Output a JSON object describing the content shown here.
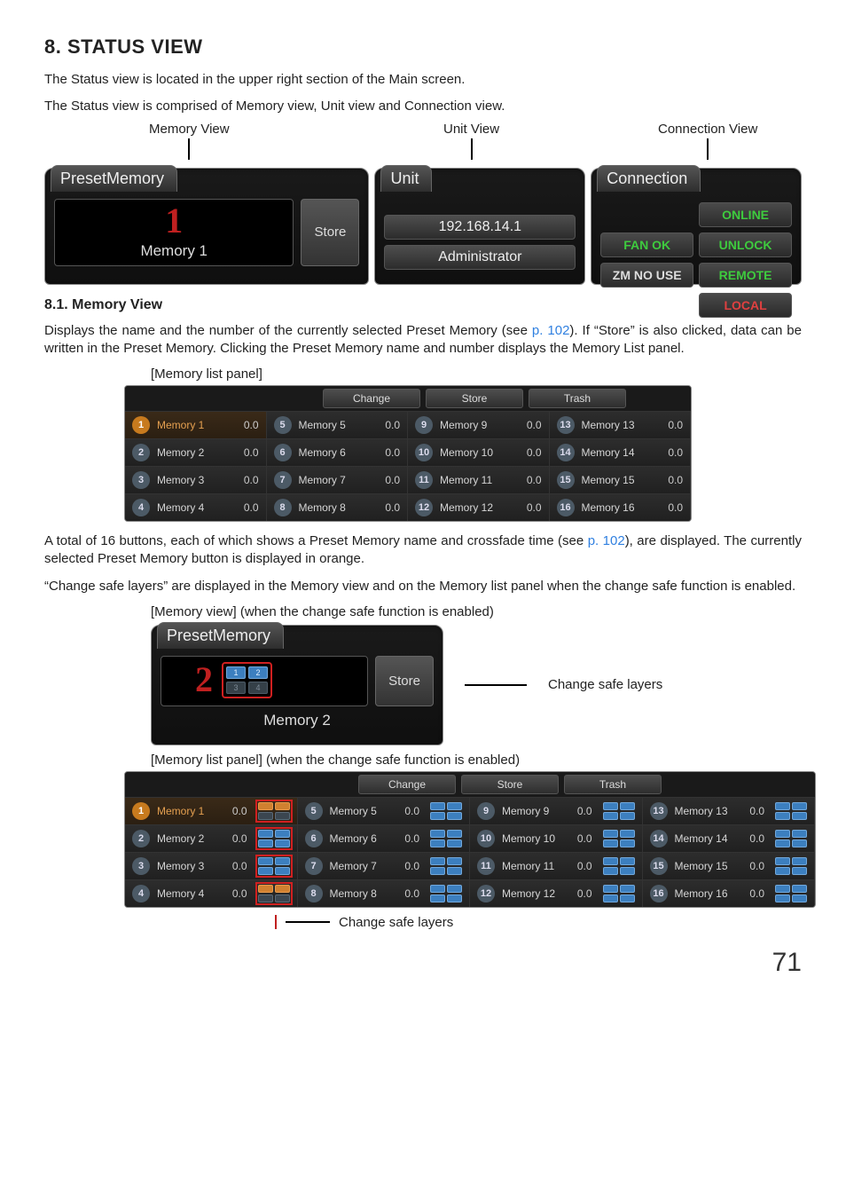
{
  "heading": "8. STATUS VIEW",
  "intro1": "The Status view is located in the upper right section of the Main screen.",
  "intro2": "The Status view is comprised of Memory view, Unit view and Connection view.",
  "labels": {
    "memory_view": "Memory View",
    "unit_view": "Unit View",
    "connection_view": "Connection View"
  },
  "status": {
    "memory": {
      "tab": "PresetMemory",
      "number": "1",
      "name": "Memory 1",
      "store": "Store"
    },
    "unit": {
      "tab": "Unit",
      "ip": "192.168.14.1",
      "role": "Administrator"
    },
    "conn": {
      "tab": "Connection",
      "online": "ONLINE",
      "fan": "FAN OK",
      "unlock": "UNLOCK",
      "zm": "ZM NO USE",
      "remote": "REMOTE",
      "local": "LOCAL"
    }
  },
  "sec81_title": "8.1. Memory View",
  "sec81_p1a": "Displays the name and the number of the currently selected Preset Memory (see ",
  "sec81_p1_link": "p. 102",
  "sec81_p1b": "). If “Store” is also clicked, data can be written in the Preset Memory. Clicking the Preset Memory name and number displays the Memory List panel.",
  "caption_memlist": "[Memory list panel]",
  "memlist_hdr": {
    "change": "Change",
    "store": "Store",
    "trash": "Trash"
  },
  "memlist": [
    {
      "n": "1",
      "name": "Memory 1",
      "t": "0.0",
      "sel": true
    },
    {
      "n": "5",
      "name": "Memory 5",
      "t": "0.0"
    },
    {
      "n": "9",
      "name": "Memory 9",
      "t": "0.0"
    },
    {
      "n": "13",
      "name": "Memory 13",
      "t": "0.0"
    },
    {
      "n": "2",
      "name": "Memory 2",
      "t": "0.0"
    },
    {
      "n": "6",
      "name": "Memory 6",
      "t": "0.0"
    },
    {
      "n": "10",
      "name": "Memory 10",
      "t": "0.0"
    },
    {
      "n": "14",
      "name": "Memory 14",
      "t": "0.0"
    },
    {
      "n": "3",
      "name": "Memory 3",
      "t": "0.0"
    },
    {
      "n": "7",
      "name": "Memory 7",
      "t": "0.0"
    },
    {
      "n": "11",
      "name": "Memory 11",
      "t": "0.0"
    },
    {
      "n": "15",
      "name": "Memory 15",
      "t": "0.0"
    },
    {
      "n": "4",
      "name": "Memory 4",
      "t": "0.0"
    },
    {
      "n": "8",
      "name": "Memory 8",
      "t": "0.0"
    },
    {
      "n": "12",
      "name": "Memory 12",
      "t": "0.0"
    },
    {
      "n": "16",
      "name": "Memory 16",
      "t": "0.0"
    }
  ],
  "para2a": "A total of 16 buttons, each of which shows a Preset Memory name and crossfade time (see ",
  "para2_link": "p. 102",
  "para2b": "), are displayed. The currently selected Preset Memory button is displayed in orange.",
  "para3": "“Change safe layers” are displayed in the Memory view and on the Memory list panel when the change safe function is enabled.",
  "caption_memview_cs": "[Memory view] (when the change safe function is enabled)",
  "preset2": {
    "tab": "PresetMemory",
    "number": "2",
    "name": "Memory 2",
    "store": "Store",
    "layer_labels": [
      "1",
      "2",
      "3",
      "4"
    ]
  },
  "callout_csl": "Change safe layers",
  "caption_memlist_cs": "[Memory list panel] (when the change safe function is enabled)",
  "memlist_cs": [
    {
      "n": "1",
      "name": "Memory 1",
      "t": "0.0",
      "sel": true,
      "layers": "hot redbox"
    },
    {
      "n": "5",
      "name": "Memory 5",
      "t": "0.0",
      "layers": "active"
    },
    {
      "n": "9",
      "name": "Memory 9",
      "t": "0.0",
      "layers": "active"
    },
    {
      "n": "13",
      "name": "Memory 13",
      "t": "0.0",
      "layers": "active"
    },
    {
      "n": "2",
      "name": "Memory 2",
      "t": "0.0",
      "layers": "active redbox"
    },
    {
      "n": "6",
      "name": "Memory 6",
      "t": "0.0",
      "layers": "active"
    },
    {
      "n": "10",
      "name": "Memory 10",
      "t": "0.0",
      "layers": "active"
    },
    {
      "n": "14",
      "name": "Memory 14",
      "t": "0.0",
      "layers": "active"
    },
    {
      "n": "3",
      "name": "Memory 3",
      "t": "0.0",
      "layers": "active redbox"
    },
    {
      "n": "7",
      "name": "Memory 7",
      "t": "0.0",
      "layers": "active"
    },
    {
      "n": "11",
      "name": "Memory 11",
      "t": "0.0",
      "layers": "active"
    },
    {
      "n": "15",
      "name": "Memory 15",
      "t": "0.0",
      "layers": "active"
    },
    {
      "n": "4",
      "name": "Memory 4",
      "t": "0.0",
      "layers": "hot redbox"
    },
    {
      "n": "8",
      "name": "Memory 8",
      "t": "0.0",
      "layers": "active"
    },
    {
      "n": "12",
      "name": "Memory 12",
      "t": "0.0",
      "layers": "active"
    },
    {
      "n": "16",
      "name": "Memory 16",
      "t": "0.0",
      "layers": "active"
    }
  ],
  "page_number": "71"
}
